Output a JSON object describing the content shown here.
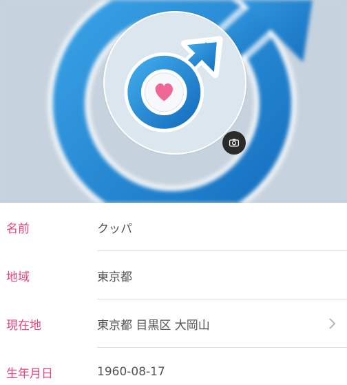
{
  "profile": {
    "avatar_icon": "male-symbol-heart-icon",
    "camera_icon": "camera-icon",
    "colors": {
      "label": "#e8457b",
      "value": "#555555",
      "icon_blue": "#1f8bd6",
      "heart": "#f06795",
      "header_bg": "#c5d2dd"
    }
  },
  "fields": [
    {
      "label": "名前",
      "value": "クッパ"
    },
    {
      "label": "地域",
      "value": "東京都"
    },
    {
      "label": "現在地",
      "value": "東京都 目黒区 大岡山"
    },
    {
      "label": "生年月日",
      "value": "1960-08-17"
    }
  ]
}
